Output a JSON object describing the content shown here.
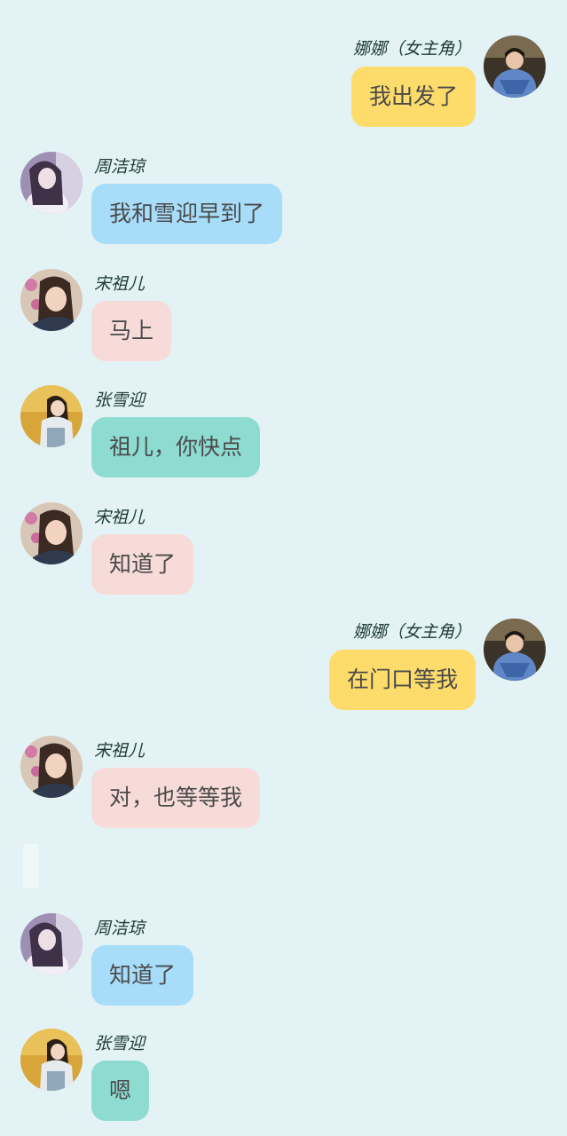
{
  "colors": {
    "background": "#e3f2f4",
    "self_bubble": "#fddc6c",
    "blue_bubble": "#a8ddfa",
    "pink_bubble": "#f7dbd9",
    "teal_bubble": "#8edbd2"
  },
  "messages": [
    {
      "sender": "娜娜（女主角）",
      "text": "我出发了",
      "side": "right",
      "avatar_icon": "heroine-avatar"
    },
    {
      "sender": "周洁琼",
      "text": "我和雪迎早到了",
      "side": "left",
      "avatar_icon": "zhou-jieqiong-avatar"
    },
    {
      "sender": "宋祖儿",
      "text": "马上",
      "side": "left",
      "avatar_icon": "song-zuer-avatar"
    },
    {
      "sender": "张雪迎",
      "text": "祖儿，你快点",
      "side": "left",
      "avatar_icon": "zhang-xueying-avatar"
    },
    {
      "sender": "宋祖儿",
      "text": "知道了",
      "side": "left",
      "avatar_icon": "song-zuer-avatar"
    },
    {
      "sender": "娜娜（女主角）",
      "text": "在门口等我",
      "side": "right",
      "avatar_icon": "heroine-avatar"
    },
    {
      "sender": "宋祖儿",
      "text": "对，也等等我",
      "side": "left",
      "avatar_icon": "song-zuer-avatar"
    },
    {
      "sender": "周洁琼",
      "text": "知道了",
      "side": "left",
      "avatar_icon": "zhou-jieqiong-avatar"
    },
    {
      "sender": "张雪迎",
      "text": "嗯",
      "side": "left",
      "avatar_icon": "zhang-xueying-avatar"
    }
  ]
}
